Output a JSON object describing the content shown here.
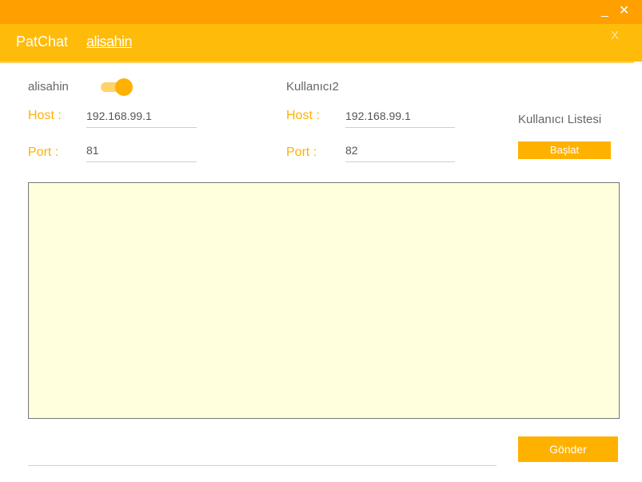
{
  "window": {
    "minimize": "_",
    "close": "✕"
  },
  "header": {
    "app_name": "PatChat",
    "username": "alisahin",
    "close_label": "X"
  },
  "left": {
    "name": "alisahin",
    "toggle_on": true,
    "host_label": "Host :",
    "host_value": "192.168.99.1",
    "port_label": "Port :",
    "port_value": "81"
  },
  "right": {
    "name": "Kullanıcı2",
    "host_label": "Host :",
    "host_value": "192.168.99.1",
    "port_label": "Port :",
    "port_value": "82"
  },
  "user_list": {
    "label": "Kullanıcı Listesi",
    "start_button": "Başlat"
  },
  "chat": {
    "messages": ""
  },
  "compose": {
    "message": "",
    "send_button": "Gönder"
  },
  "colors": {
    "titlebar": "#ff9f00",
    "header": "#ffbb0a",
    "accent": "#ffb100",
    "chat_bg": "#ffffdd"
  }
}
